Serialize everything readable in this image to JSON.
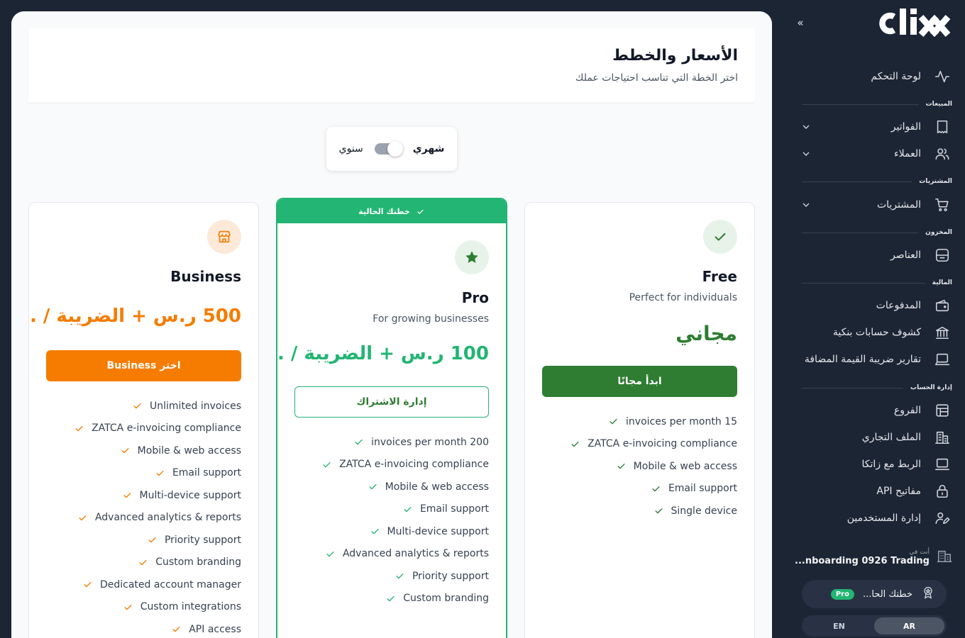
{
  "app": {
    "logo_text": "CLIX",
    "collapse_icon": "»"
  },
  "colors": {
    "sidebar_bg": "#1c2534",
    "green": "#22b573",
    "dark_green": "#2e7d32",
    "orange": "#f57c00"
  },
  "sidebar": {
    "dashboard": "لوحة التحكم",
    "sections": {
      "sales": "المبيعات",
      "purchases": "المشتريات",
      "inventory": "المخزون",
      "finance": "المالية",
      "account": "إدارة الحساب"
    },
    "items": {
      "invoices": "الفواتير",
      "customers": "العملاء",
      "purchases": "المشتريات",
      "items": "العناصر",
      "payments": "المدفوعات",
      "bank_statements": "كشوف حسابات بنكية",
      "vat_reports": "تقارير ضريبة القيمة المضافة",
      "branches": "الفروع",
      "business_profile": "الملف التجاري",
      "zatca": "الربط مع زاتكا",
      "api_keys": "مفاتيح API",
      "user_management": "إدارة المستخدمين"
    },
    "company": {
      "label": "أنت في",
      "name": "...nboarding 0926 Trading"
    },
    "plan": {
      "label": "خطتك الحا...",
      "badge": "Pro"
    },
    "language": {
      "ar": "AR",
      "en": "EN",
      "active": "AR"
    }
  },
  "header": {
    "title": "الأسعار والخطط",
    "subtitle": "اختر الخطة التي تناسب احتياجات عملك"
  },
  "billing_toggle": {
    "monthly": "شهري",
    "yearly": "سنوي",
    "selected": "monthly"
  },
  "plans": {
    "free": {
      "name": "Free",
      "description": "Perfect for individuals",
      "price": "مجاني",
      "button": "ابدأ مجانًا",
      "icon": "check-icon",
      "features": [
        "invoices per month 15",
        "ZATCA e-invoicing compliance",
        "Mobile & web access",
        "Email support",
        "Single device"
      ]
    },
    "pro": {
      "current_label": "خطتك الحالية",
      "name": "Pro",
      "description": "For growing businesses",
      "price": "100 ر.س + الضريبة / ...",
      "button": "إدارة الاشتراك",
      "icon": "star-icon",
      "features": [
        "invoices per month 200",
        "ZATCA e-invoicing compliance",
        "Mobile & web access",
        "Email support",
        "Multi-device support",
        "Advanced analytics & reports",
        "Priority support",
        "Custom branding"
      ]
    },
    "business": {
      "name": "Business",
      "price": "500 ر.س + الضريبة / ...",
      "button": "اختر Business",
      "icon": "store-icon",
      "features": [
        "Unlimited invoices",
        "ZATCA e-invoicing compliance",
        "Mobile & web access",
        "Email support",
        "Multi-device support",
        "Advanced analytics & reports",
        "Priority support",
        "Custom branding",
        "Dedicated account manager",
        "Custom integrations",
        "API access"
      ]
    }
  }
}
